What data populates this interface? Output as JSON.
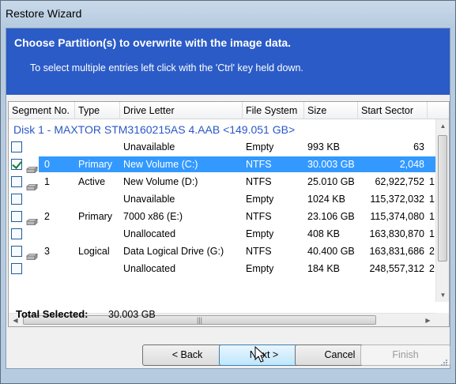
{
  "window": {
    "title": "Restore Wizard"
  },
  "header": {
    "title": "Choose  Partition(s)  to overwrite with the image data.",
    "subtitle": "To select multiple entries left click with the 'Ctrl' key held down."
  },
  "columns": [
    "Segment No.",
    "Type",
    "Drive Letter",
    "File System",
    "Size",
    "Start Sector"
  ],
  "disk_label": "Disk 1 - MAXTOR STM3160215AS 4.AAB  <149.051 GB>",
  "rows": [
    {
      "checked": false,
      "selected": false,
      "icon": false,
      "seg": "",
      "type": "",
      "drive": "Unavailable",
      "fs": "Empty",
      "size": "993 KB",
      "start": "63",
      "extra": ""
    },
    {
      "checked": true,
      "selected": true,
      "icon": true,
      "seg": "0",
      "type": "Primary",
      "drive": "New Volume (C:)",
      "fs": "NTFS",
      "size": "30.003 GB",
      "start": "2,048",
      "extra": ""
    },
    {
      "checked": false,
      "selected": false,
      "icon": true,
      "seg": "1",
      "type": "Active",
      "drive": "New Volume (D:)",
      "fs": "NTFS",
      "size": "25.010 GB",
      "start": "62,922,752",
      "extra": "1"
    },
    {
      "checked": false,
      "selected": false,
      "icon": false,
      "seg": "",
      "type": "",
      "drive": "Unavailable",
      "fs": "Empty",
      "size": "1024 KB",
      "start": "115,372,032",
      "extra": "1"
    },
    {
      "checked": false,
      "selected": false,
      "icon": true,
      "seg": "2",
      "type": "Primary",
      "drive": "7000 x86 (E:)",
      "fs": "NTFS",
      "size": "23.106 GB",
      "start": "115,374,080",
      "extra": "1"
    },
    {
      "checked": false,
      "selected": false,
      "icon": false,
      "seg": "",
      "type": "",
      "drive": "Unallocated",
      "fs": "Empty",
      "size": "408 KB",
      "start": "163,830,870",
      "extra": "1"
    },
    {
      "checked": false,
      "selected": false,
      "icon": true,
      "seg": "3",
      "type": "Logical",
      "drive": "Data Logical Drive (G:)",
      "fs": "NTFS",
      "size": "40.400 GB",
      "start": "163,831,686",
      "extra": "2"
    },
    {
      "checked": false,
      "selected": false,
      "icon": false,
      "seg": "",
      "type": "",
      "drive": "Unallocated",
      "fs": "Empty",
      "size": "184 KB",
      "start": "248,557,312",
      "extra": "2"
    }
  ],
  "total": {
    "label": "Total Selected:",
    "value": "30.003 GB"
  },
  "buttons": {
    "back": "< Back",
    "next": "Next >",
    "cancel": "Cancel",
    "finish": "Finish"
  },
  "icons": {
    "drive": "hard-drive-icon",
    "checkbox": "checkbox-icon",
    "cursor": "mouse-pointer-icon"
  },
  "colors": {
    "header_bg": "#2b5bc6",
    "selection": "#3399ff",
    "disk_text": "#2a57c7"
  }
}
